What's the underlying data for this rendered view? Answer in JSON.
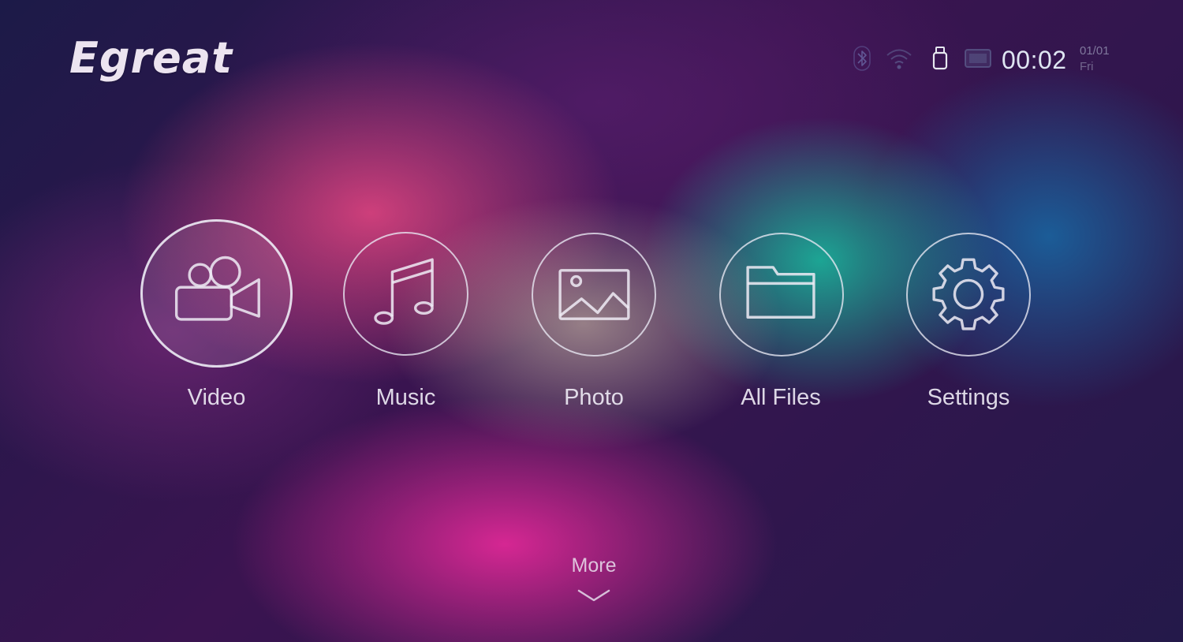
{
  "brand": {
    "logo_text": "Egreat"
  },
  "status_bar": {
    "icons": [
      "bluetooth-icon",
      "wifi-icon",
      "usb-drive-icon",
      "display-icon"
    ],
    "time": "00:02",
    "date": "01/01",
    "weekday": "Fri"
  },
  "menu": {
    "items": [
      {
        "label": "Video",
        "icon": "video-camera-icon",
        "focused": true
      },
      {
        "label": "Music",
        "icon": "music-note-icon",
        "focused": false
      },
      {
        "label": "Photo",
        "icon": "photo-icon",
        "focused": false
      },
      {
        "label": "All Files",
        "icon": "folder-icon",
        "focused": false
      },
      {
        "label": "Settings",
        "icon": "gear-icon",
        "focused": false
      }
    ]
  },
  "more": {
    "label": "More",
    "icon": "chevron-down-icon"
  },
  "colors": {
    "text": "#ece4f0",
    "ring": "#ebebf5",
    "background_base": "#2a1848"
  }
}
